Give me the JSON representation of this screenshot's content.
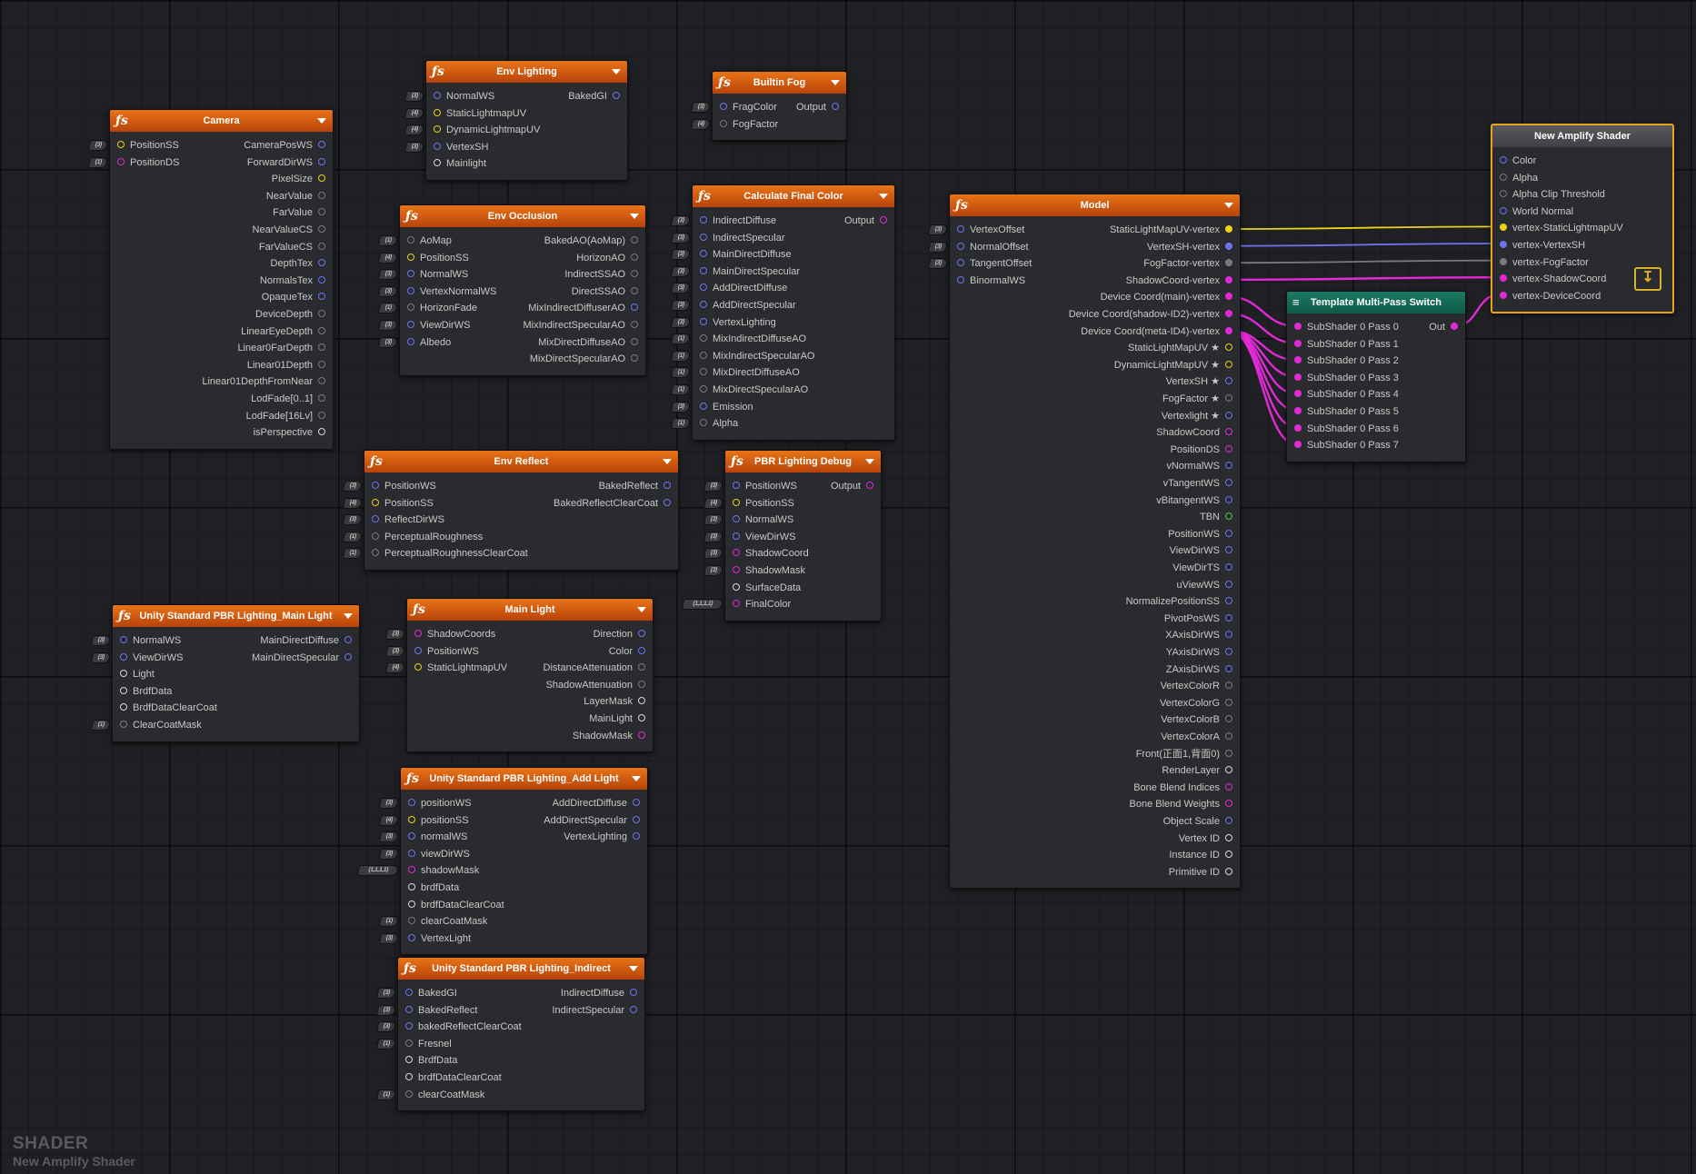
{
  "pin_colors": {
    "blue": "#6f72f0",
    "yellow": "#e9d21c",
    "magenta": "#e12ad6",
    "gray": "#7a7a7a",
    "white": "#d8d8d8",
    "green": "#4cc94c"
  },
  "stubs": [
    "(3)",
    "(4)",
    "(2)",
    "(1)",
    "(1,1,1,1)"
  ],
  "nodes": [
    {
      "id": "camera",
      "title": "Camera",
      "inputs": [
        [
          "PositionSS",
          "yellow"
        ],
        [
          "PositionDS",
          "magenta"
        ]
      ],
      "outputs": [
        [
          "CameraPosWS",
          "blue"
        ],
        [
          "ForwardDirWS",
          "blue"
        ],
        [
          "PixelSize",
          "yellow"
        ],
        [
          "NearValue",
          "gray"
        ],
        [
          "FarValue",
          "gray"
        ],
        [
          "NearValueCS",
          "gray"
        ],
        [
          "FarValueCS",
          "gray"
        ],
        [
          "DepthTex",
          "blue"
        ],
        [
          "NormalsTex",
          "blue"
        ],
        [
          "OpaqueTex",
          "blue"
        ],
        [
          "DeviceDepth",
          "gray"
        ],
        [
          "LinearEyeDepth",
          "gray"
        ],
        [
          "Linear0FarDepth",
          "gray"
        ],
        [
          "Linear01Depth",
          "gray"
        ],
        [
          "Linear01DepthFromNear",
          "gray"
        ],
        [
          "LodFade[0..1]",
          "gray"
        ],
        [
          "LodFade[16Lv]",
          "gray"
        ],
        [
          "isPerspective",
          "white"
        ]
      ]
    },
    {
      "id": "env-lighting",
      "title": "Env Lighting",
      "inputs": [
        [
          "NormalWS",
          "blue"
        ],
        [
          "StaticLightmapUV",
          "yellow"
        ],
        [
          "DynamicLightmapUV",
          "yellow"
        ],
        [
          "VertexSH",
          "blue"
        ],
        [
          "Mainlight",
          "white"
        ]
      ],
      "outputs": [
        [
          "BakedGI",
          "blue"
        ]
      ]
    },
    {
      "id": "builtin-fog",
      "title": "Builtin Fog",
      "inputs": [
        [
          "FragColor",
          "blue"
        ],
        [
          "FogFactor",
          "gray"
        ]
      ],
      "outputs": [
        [
          "Output",
          "blue"
        ]
      ]
    },
    {
      "id": "env-occlusion",
      "title": "Env Occlusion",
      "inputs": [
        [
          "AoMap",
          "gray"
        ],
        [
          "PositionSS",
          "yellow"
        ],
        [
          "NormalWS",
          "blue"
        ],
        [
          "VertexNormalWS",
          "blue"
        ],
        [
          "HorizonFade",
          "gray"
        ],
        [
          "ViewDirWS",
          "blue"
        ],
        [
          "Albedo",
          "blue"
        ]
      ],
      "outputs": [
        [
          "BakedAO(AoMap)",
          "gray"
        ],
        [
          "HorizonAO",
          "gray"
        ],
        [
          "IndirectSSAO",
          "gray"
        ],
        [
          "DirectSSAO",
          "gray"
        ],
        [
          "MixIndirectDiffuserAO",
          "blue"
        ],
        [
          "MixIndirectSpecularAO",
          "gray"
        ],
        [
          "MixDirectDiffuseAO",
          "gray"
        ],
        [
          "MixDirectSpecularAO",
          "gray"
        ]
      ]
    },
    {
      "id": "calculate-final-color",
      "title": "Calculate Final Color",
      "inputs": [
        [
          "IndirectDiffuse",
          "blue"
        ],
        [
          "IndirectSpecular",
          "blue"
        ],
        [
          "MainDirectDiffuse",
          "blue"
        ],
        [
          "MainDirectSpecular",
          "blue"
        ],
        [
          "AddDirectDiffuse",
          "blue"
        ],
        [
          "AddDirectSpecular",
          "blue"
        ],
        [
          "VertexLighting",
          "blue"
        ],
        [
          "MixIndirectDiffuseAO",
          "gray"
        ],
        [
          "MixIndirectSpecularAO",
          "gray"
        ],
        [
          "MixDirectDiffuseAO",
          "gray"
        ],
        [
          "MixDirectSpecularAO",
          "gray"
        ],
        [
          "Emission",
          "blue"
        ],
        [
          "Alpha",
          "gray"
        ]
      ],
      "outputs": [
        [
          "Output",
          "magenta"
        ]
      ]
    },
    {
      "id": "model",
      "title": "Model",
      "inputs": [
        [
          "VertexOffset",
          "blue"
        ],
        [
          "NormalOffset",
          "blue"
        ],
        [
          "TangentOffset",
          "blue"
        ],
        [
          "BinormalWS",
          "blue"
        ]
      ],
      "outputs": [
        [
          "StaticLightMapUV-vertex",
          "yellowF"
        ],
        [
          "VertexSH-vertex",
          "blueF"
        ],
        [
          "FogFactor-vertex",
          "grayF"
        ],
        [
          "ShadowCoord-vertex",
          "magentaF"
        ],
        [
          "Device Coord(main)-vertex",
          "magentaF"
        ],
        [
          "Device Coord(shadow-ID2)-vertex",
          "magentaF"
        ],
        [
          "Device Coord(meta-ID4)-vertex",
          "magentaF"
        ],
        [
          "StaticLightMapUV ★",
          "yellow"
        ],
        [
          "DynamicLightMapUV ★",
          "yellow"
        ],
        [
          "VertexSH ★",
          "blue"
        ],
        [
          "FogFactor ★",
          "gray"
        ],
        [
          "Vertexlight ★",
          "blue"
        ],
        [
          "ShadowCoord",
          "magenta"
        ],
        [
          "PositionDS",
          "magenta"
        ],
        [
          "vNormalWS",
          "blue"
        ],
        [
          "vTangentWS",
          "blue"
        ],
        [
          "vBitangentWS",
          "blue"
        ],
        [
          "TBN",
          "green"
        ],
        [
          "PositionWS",
          "blue"
        ],
        [
          "ViewDirWS",
          "blue"
        ],
        [
          "ViewDirTS",
          "blue"
        ],
        [
          "uViewWS",
          "blue"
        ],
        [
          "NormalizePositionSS",
          "blue"
        ],
        [
          "PivotPosWS",
          "blue"
        ],
        [
          "XAxisDirWS",
          "blue"
        ],
        [
          "YAxisDirWS",
          "blue"
        ],
        [
          "ZAxisDirWS",
          "blue"
        ],
        [
          "VertexColorR",
          "gray"
        ],
        [
          "VertexColorG",
          "gray"
        ],
        [
          "VertexColorB",
          "gray"
        ],
        [
          "VertexColorA",
          "gray"
        ],
        [
          "Front(正面1,背面0)",
          "gray"
        ],
        [
          "RenderLayer",
          "white"
        ],
        [
          "Bone Blend Indices",
          "magenta"
        ],
        [
          "Bone Blend Weights",
          "magenta"
        ],
        [
          "Object Scale",
          "blue"
        ],
        [
          "Vertex ID",
          "white"
        ],
        [
          "Instance ID",
          "white"
        ],
        [
          "Primitive ID",
          "white"
        ]
      ]
    },
    {
      "id": "template-multi-pass-switch",
      "title": "Template Multi-Pass Switch",
      "inputs": [
        [
          "SubShader 0 Pass 0",
          "magentaF"
        ],
        [
          "SubShader 0 Pass 1",
          "magentaF"
        ],
        [
          "SubShader 0 Pass 2",
          "magentaF"
        ],
        [
          "SubShader 0 Pass 3",
          "magentaF"
        ],
        [
          "SubShader 0 Pass 4",
          "magentaF"
        ],
        [
          "SubShader 0 Pass 5",
          "magentaF"
        ],
        [
          "SubShader 0 Pass 6",
          "magentaF"
        ],
        [
          "SubShader 0 Pass 7",
          "magentaF"
        ]
      ],
      "outputs": [
        [
          "Out",
          "magentaF"
        ]
      ]
    },
    {
      "id": "new-amplify-shader",
      "title": "New Amplify Shader",
      "inputs": [
        [
          "Color",
          "blue"
        ],
        [
          "Alpha",
          "gray"
        ],
        [
          "Alpha Clip Threshold",
          "gray"
        ],
        [
          "World Normal",
          "blue"
        ],
        [
          "vertex-StaticLightmapUV",
          "yellowF"
        ],
        [
          "vertex-VertexSH",
          "blueF"
        ],
        [
          "vertex-FogFactor",
          "grayF"
        ],
        [
          "vertex-ShadowCoord",
          "magentaF"
        ],
        [
          "vertex-DeviceCoord",
          "magentaF"
        ]
      ],
      "outputs": []
    },
    {
      "id": "env-reflect",
      "title": "Env Reflect",
      "inputs": [
        [
          "PositionWS",
          "blue"
        ],
        [
          "PositionSS",
          "yellow"
        ],
        [
          "ReflectDirWS",
          "blue"
        ],
        [
          "PerceptualRoughness",
          "gray"
        ],
        [
          "PerceptualRoughnessClearCoat",
          "gray"
        ]
      ],
      "outputs": [
        [
          "BakedReflect",
          "blue"
        ],
        [
          "BakedReflectClearCoat",
          "blue"
        ]
      ]
    },
    {
      "id": "pbr-lighting-debug",
      "title": "PBR Lighting Debug",
      "inputs": [
        [
          "PositionWS",
          "blue"
        ],
        [
          "PositionSS",
          "yellow"
        ],
        [
          "NormalWS",
          "blue"
        ],
        [
          "ViewDirWS",
          "blue"
        ],
        [
          "ShadowCoord",
          "magenta"
        ],
        [
          "ShadowMask",
          "magenta"
        ],
        [
          "SurfaceData",
          "white"
        ],
        [
          "FinalColor",
          "magenta"
        ]
      ],
      "outputs": [
        [
          "Output",
          "magenta"
        ]
      ]
    },
    {
      "id": "main-light-pbr",
      "title": "Unity Standard PBR Lighting_Main Light",
      "inputs": [
        [
          "NormalWS",
          "blue"
        ],
        [
          "ViewDirWS",
          "blue"
        ],
        [
          "Light",
          "white"
        ],
        [
          "BrdfData",
          "white"
        ],
        [
          "BrdfDataClearCoat",
          "white"
        ],
        [
          "ClearCoatMask",
          "gray"
        ]
      ],
      "outputs": [
        [
          "MainDirectDiffuse",
          "blue"
        ],
        [
          "MainDirectSpecular",
          "blue"
        ]
      ]
    },
    {
      "id": "main-light",
      "title": "Main Light",
      "inputs": [
        [
          "ShadowCoords",
          "magenta"
        ],
        [
          "PositionWS",
          "blue"
        ],
        [
          "StaticLightmapUV",
          "yellow"
        ]
      ],
      "outputs": [
        [
          "Direction",
          "blue"
        ],
        [
          "Color",
          "blue"
        ],
        [
          "DistanceAttenuation",
          "gray"
        ],
        [
          "ShadowAttenuation",
          "gray"
        ],
        [
          "LayerMask",
          "white"
        ],
        [
          "MainLight",
          "white"
        ],
        [
          "ShadowMask",
          "magenta"
        ]
      ]
    },
    {
      "id": "add-light-pbr",
      "title": "Unity Standard PBR Lighting_Add Light",
      "inputs": [
        [
          "positionWS",
          "blue"
        ],
        [
          "positionSS",
          "yellow"
        ],
        [
          "normalWS",
          "blue"
        ],
        [
          "viewDirWS",
          "blue"
        ],
        [
          "shadowMask",
          "magenta"
        ],
        [
          "brdfData",
          "white"
        ],
        [
          "brdfDataClearCoat",
          "white"
        ],
        [
          "clearCoatMask",
          "gray"
        ],
        [
          "VertexLight",
          "blue"
        ]
      ],
      "outputs": [
        [
          "AddDirectDiffuse",
          "blue"
        ],
        [
          "AddDirectSpecular",
          "blue"
        ],
        [
          "VertexLighting",
          "blue"
        ]
      ]
    },
    {
      "id": "indirect-pbr",
      "title": "Unity Standard PBR Lighting_Indirect",
      "inputs": [
        [
          "BakedGI",
          "blue"
        ],
        [
          "BakedReflect",
          "blue"
        ],
        [
          "bakedReflectClearCoat",
          "blue"
        ],
        [
          "Fresnel",
          "gray"
        ],
        [
          "BrdfData",
          "white"
        ],
        [
          "brdfDataClearCoat",
          "white"
        ],
        [
          "clearCoatMask",
          "gray"
        ]
      ],
      "outputs": [
        [
          "IndirectDiffuse",
          "blue"
        ],
        [
          "IndirectSpecular",
          "blue"
        ]
      ]
    }
  ],
  "watermark": {
    "line1": "SHADER",
    "line2": "New Amplify Shader"
  }
}
